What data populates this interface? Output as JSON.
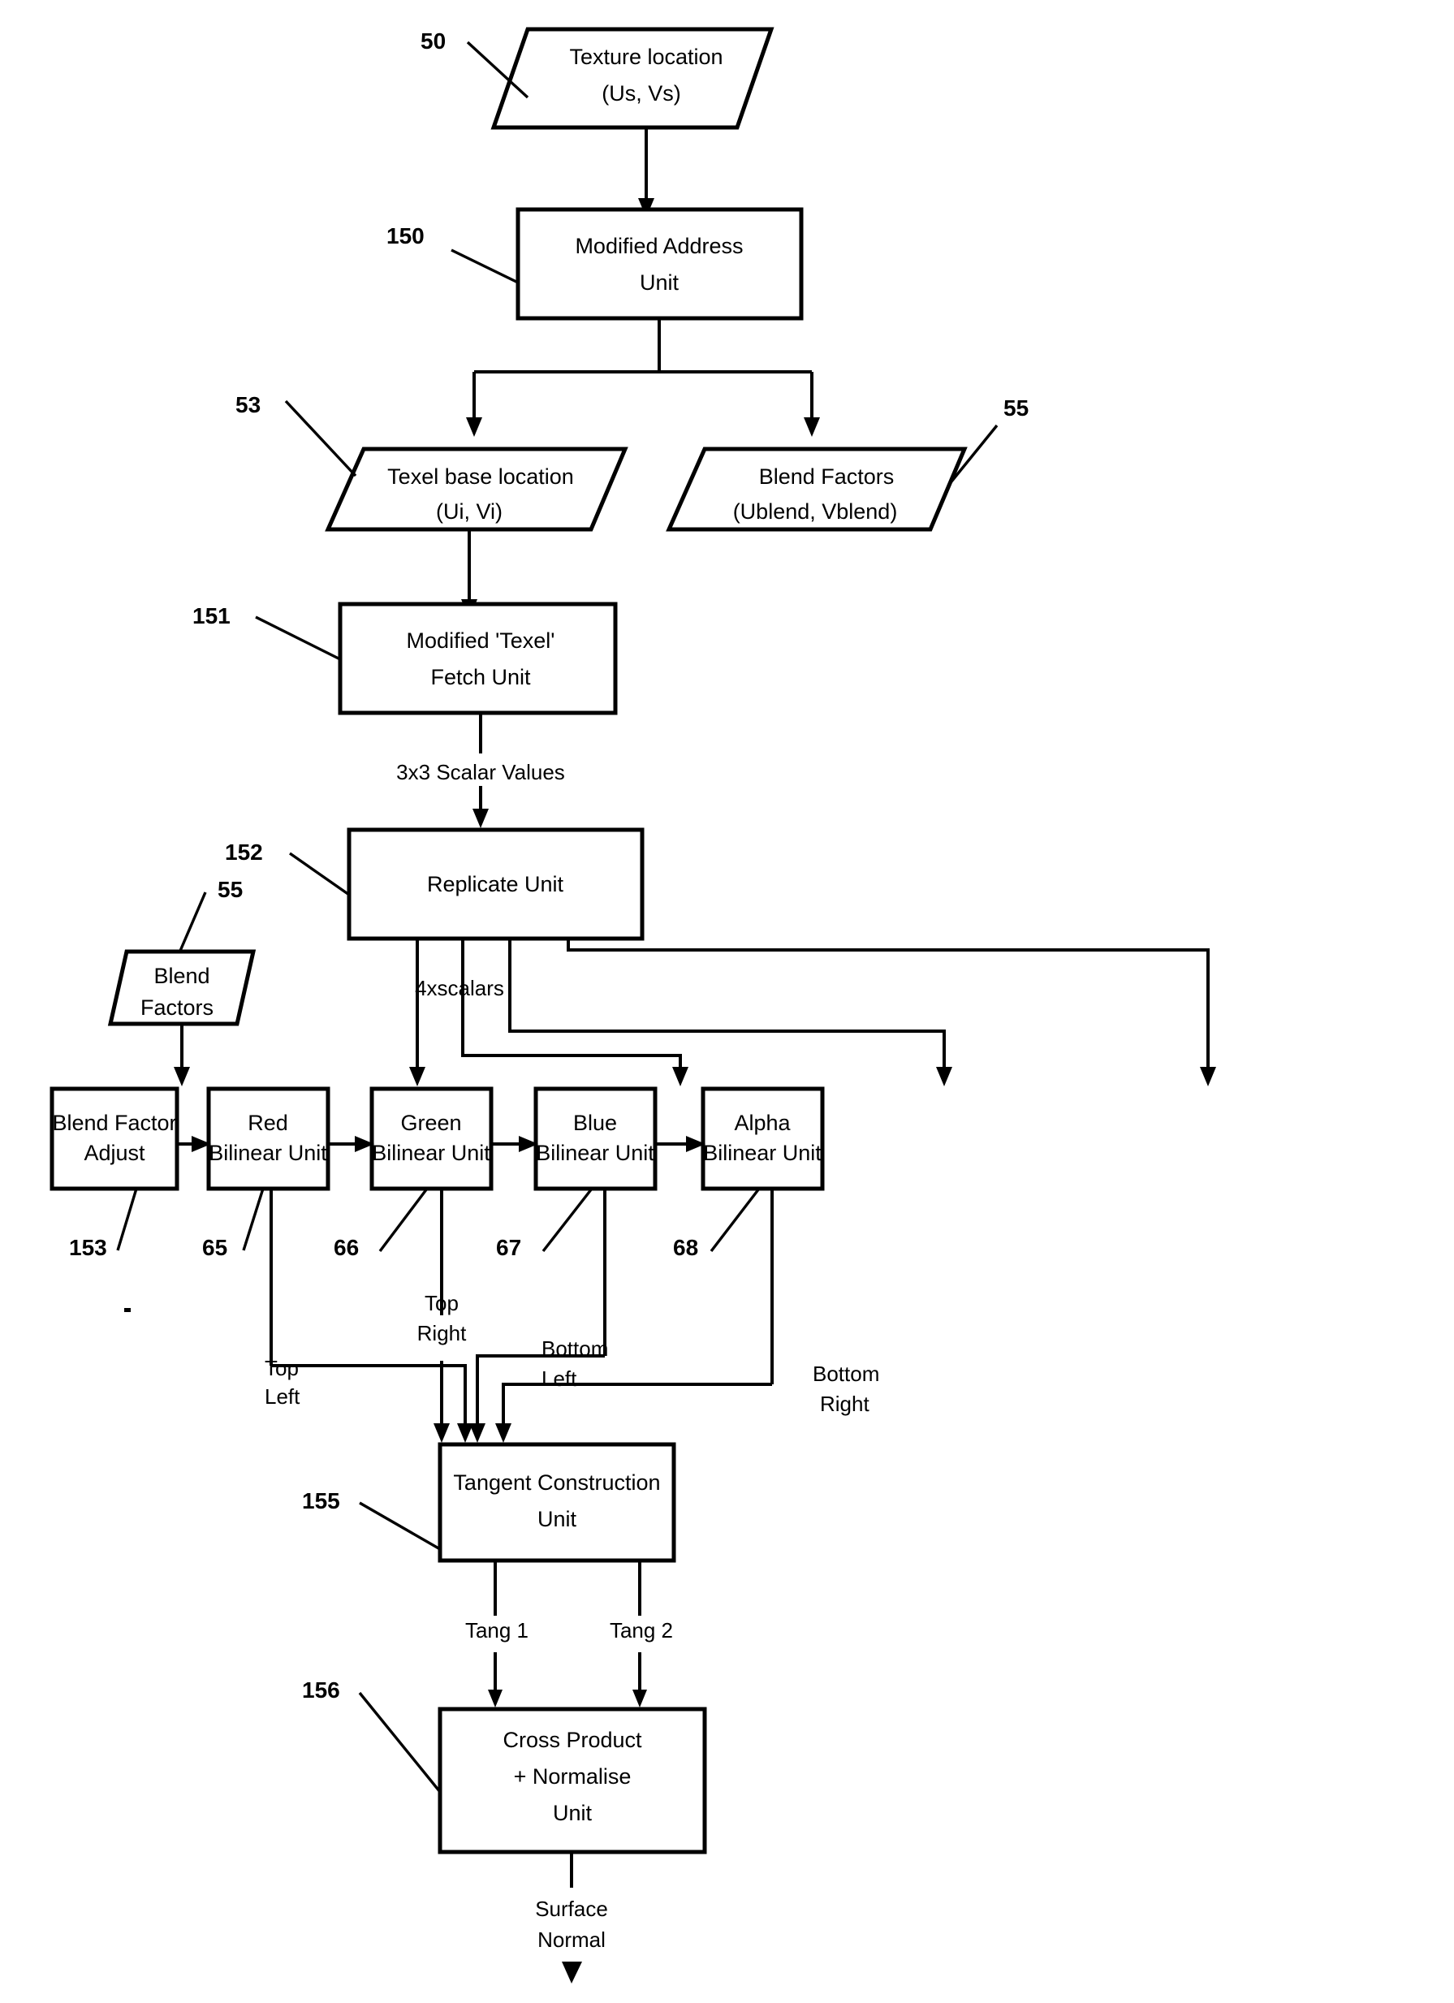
{
  "figure": {
    "title": "Texture surface-normal generation pipeline block diagram",
    "background_color": "#ffffff",
    "line_color": "#000000"
  },
  "nodes": [
    {
      "id": "texture_location",
      "shape": "parallelogram",
      "ref": "50",
      "lines": [
        "Texture location",
        "(Us, Vs)"
      ]
    },
    {
      "id": "modified_address_unit",
      "shape": "rect",
      "ref": "150",
      "lines": [
        "Modified Address",
        "Unit"
      ]
    },
    {
      "id": "texel_base_location",
      "shape": "parallelogram",
      "ref": "53",
      "lines": [
        "Texel base location",
        "(Ui, Vi)"
      ]
    },
    {
      "id": "blend_factors_top",
      "shape": "parallelogram",
      "ref": "55",
      "lines": [
        "Blend Factors",
        "(Ublend, Vblend)"
      ]
    },
    {
      "id": "modified_texel_fetch_unit",
      "shape": "rect",
      "ref": "151",
      "lines": [
        "Modified 'Texel'",
        "Fetch Unit"
      ]
    },
    {
      "id": "replicate_unit",
      "shape": "rect",
      "ref": "152",
      "lines": [
        "Replicate Unit"
      ]
    },
    {
      "id": "blend_factors_small",
      "shape": "parallelogram",
      "ref": "55",
      "lines": [
        "Blend",
        "Factors"
      ]
    },
    {
      "id": "blend_factor_adjust",
      "shape": "rect",
      "ref": "153",
      "lines": [
        "Blend Factor",
        "Adjust"
      ]
    },
    {
      "id": "red_bilinear_unit",
      "shape": "rect",
      "ref": "65",
      "lines": [
        "Red",
        "Bilinear Unit"
      ]
    },
    {
      "id": "green_bilinear_unit",
      "shape": "rect",
      "ref": "66",
      "lines": [
        "Green",
        "Bilinear Unit"
      ]
    },
    {
      "id": "blue_bilinear_unit",
      "shape": "rect",
      "ref": "67",
      "lines": [
        "Blue",
        "Bilinear Unit"
      ]
    },
    {
      "id": "alpha_bilinear_unit",
      "shape": "rect",
      "ref": "68",
      "lines": [
        "Alpha",
        "Bilinear Unit"
      ]
    },
    {
      "id": "tangent_construction_unit",
      "shape": "rect",
      "ref": "155",
      "lines": [
        "Tangent Construction",
        "Unit"
      ]
    },
    {
      "id": "cross_product_normalise_unit",
      "shape": "rect",
      "ref": "156",
      "lines": [
        "Cross Product",
        "+ Normalise",
        "Unit"
      ]
    }
  ],
  "node_text": {
    "texture_location": {
      "l1": "Texture location",
      "l2": "(Us, Vs)"
    },
    "modified_address_unit": {
      "l1": "Modified Address",
      "l2": "Unit"
    },
    "texel_base_location": {
      "l1": "Texel base location",
      "l2": "(Ui, Vi)"
    },
    "blend_factors_top": {
      "l1": "Blend Factors",
      "l2": "(Ublend, Vblend)"
    },
    "modified_texel_fetch_unit": {
      "l1": "Modified 'Texel'",
      "l2": "Fetch Unit"
    },
    "replicate_unit": {
      "l1": "Replicate Unit"
    },
    "blend_factors_small": {
      "l1": "Blend",
      "l2": "Factors"
    },
    "blend_factor_adjust": {
      "l1": "Blend Factor",
      "l2": "Adjust"
    },
    "red_bilinear_unit": {
      "l1": "Red",
      "l2": "Bilinear Unit"
    },
    "green_bilinear_unit": {
      "l1": "Green",
      "l2": "Bilinear Unit"
    },
    "blue_bilinear_unit": {
      "l1": "Blue",
      "l2": "Bilinear Unit"
    },
    "alpha_bilinear_unit": {
      "l1": "Alpha",
      "l2": "Bilinear Unit"
    },
    "tangent_construction_unit": {
      "l1": "Tangent Construction",
      "l2": "Unit"
    },
    "cross_product_normalise_unit": {
      "l1": "Cross Product",
      "l2": "+ Normalise",
      "l3": "Unit"
    }
  },
  "ref_numbers": {
    "texture_location": "50",
    "modified_address_unit": "150",
    "texel_base_location": "53",
    "blend_factors_top": "55",
    "modified_texel_fetch_unit": "151",
    "replicate_unit": "152",
    "blend_factors_small": "55",
    "blend_factor_adjust": "153",
    "red_bilinear_unit": "65",
    "green_bilinear_unit": "66",
    "blue_bilinear_unit": "67",
    "alpha_bilinear_unit": "68",
    "tangent_construction_unit": "155",
    "cross_product_normalise_unit": "156"
  },
  "edge_labels": {
    "scalar_values": "3x3 Scalar Values",
    "four_x_scalars": "4xscalars",
    "top_left_1": "Top",
    "top_left_2": "Left",
    "top_right_1": "Top",
    "top_right_2": "Right",
    "bottom_left_1": "Bottom",
    "bottom_left_2": "Left",
    "bottom_right_1": "Bottom",
    "bottom_right_2": "Right",
    "tang_1": "Tang 1",
    "tang_2": "Tang 2",
    "surface_normal_1": "Surface",
    "surface_normal_2": "Normal"
  }
}
